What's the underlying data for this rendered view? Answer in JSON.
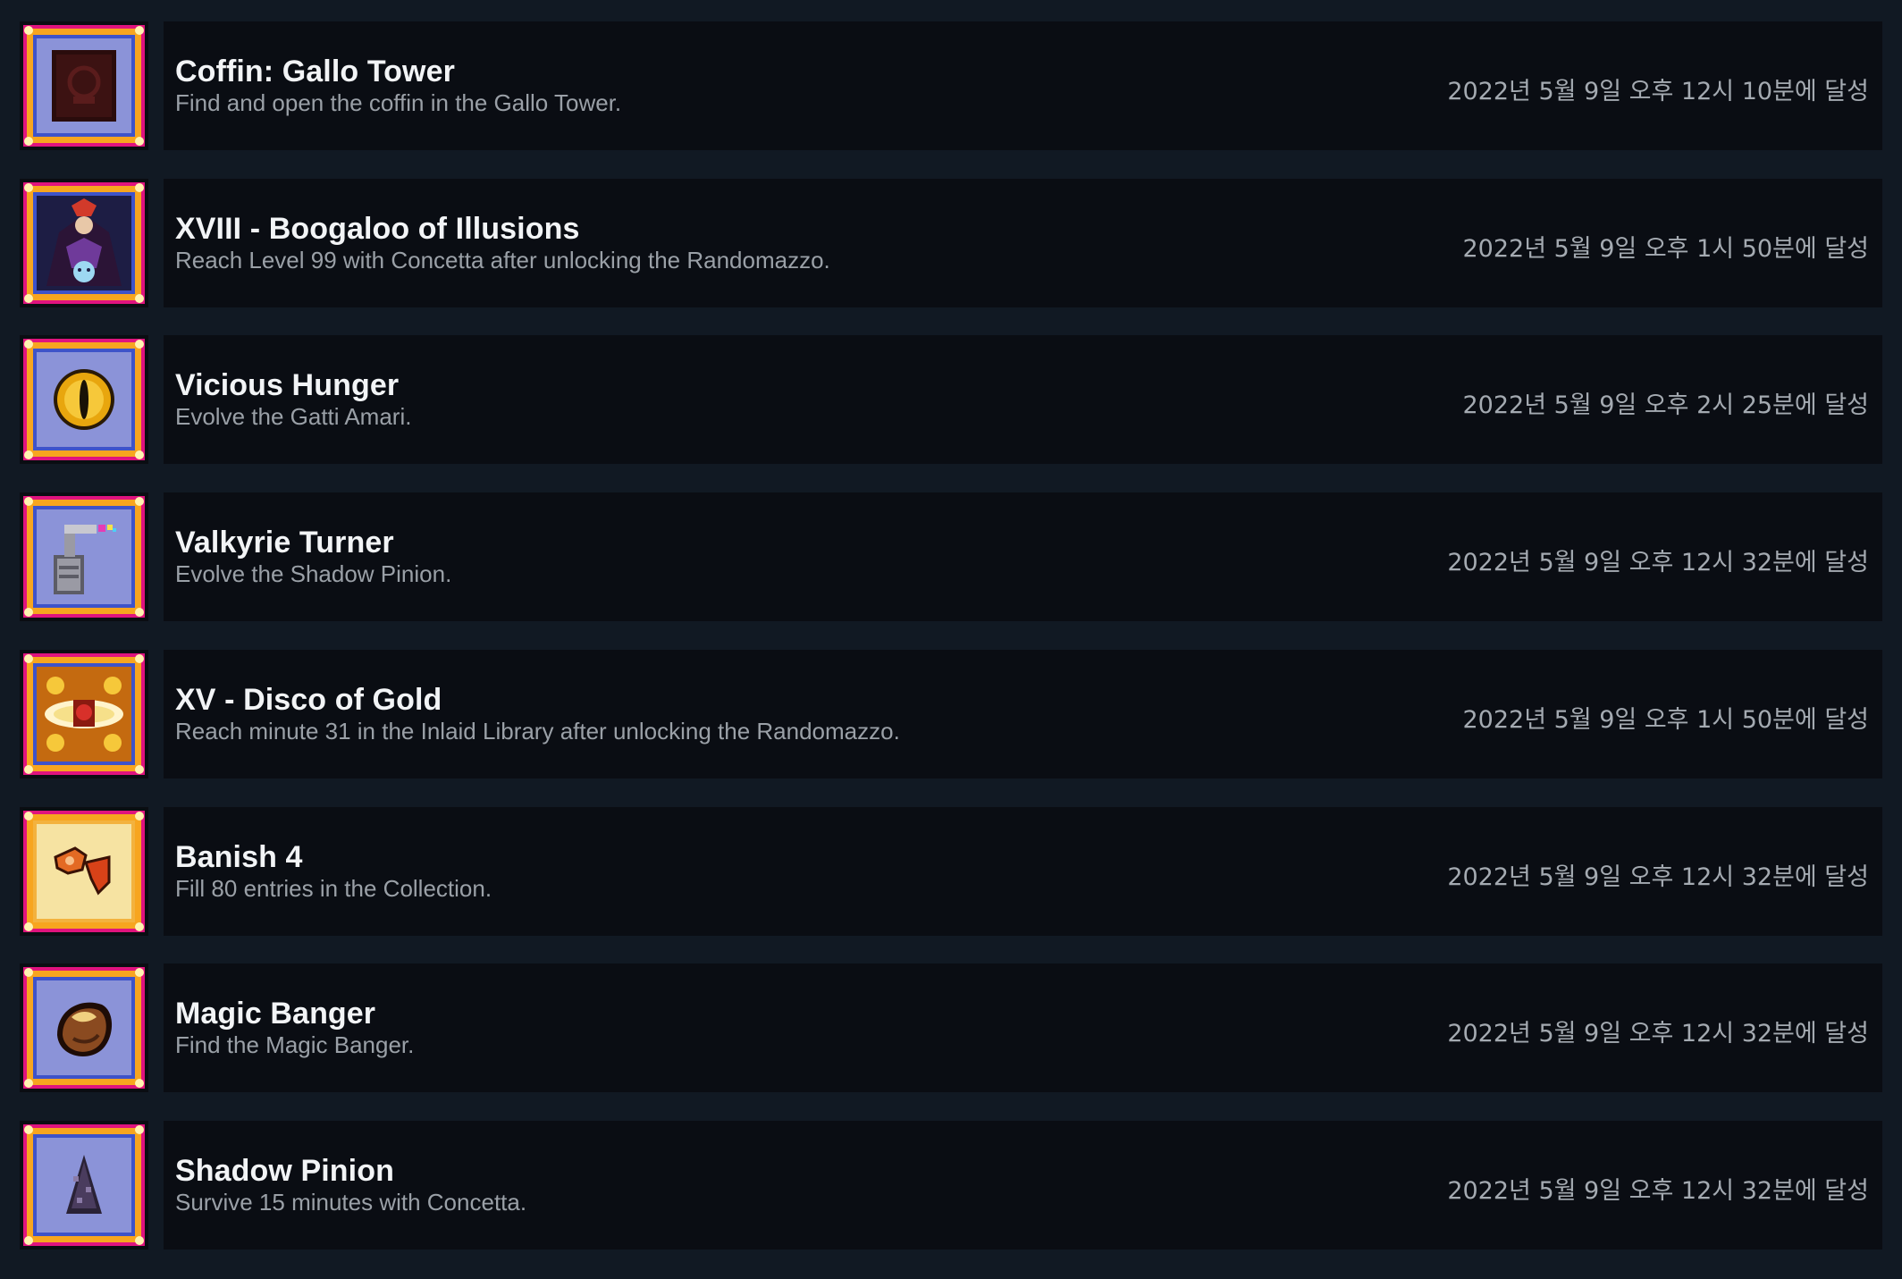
{
  "achievements": [
    {
      "title": "Coffin: Gallo Tower",
      "description": "Find and open the coffin in the Gallo Tower.",
      "unlocked": "2022년 5월 9일 오후 12시 10분에 달성",
      "icon": "coffin-icon"
    },
    {
      "title": "XVIII - Boogaloo of Illusions",
      "description": "Reach Level 99 with Concetta after unlocking the Randomazzo.",
      "unlocked": "2022년 5월 9일 오후 1시 50분에 달성",
      "icon": "boogaloo-character-icon"
    },
    {
      "title": "Vicious Hunger",
      "description": "Evolve the Gatti Amari.",
      "unlocked": "2022년 5월 9일 오후 2시 25분에 달성",
      "icon": "golden-eye-icon"
    },
    {
      "title": "Valkyrie Turner",
      "description": "Evolve the Shadow Pinion.",
      "unlocked": "2022년 5월 9일 오후 12시 32분에 달성",
      "icon": "valkyrie-turner-icon"
    },
    {
      "title": "XV - Disco of Gold",
      "description": "Reach minute 31 in the Inlaid Library after unlocking the Randomazzo.",
      "unlocked": "2022년 5월 9일 오후 1시 50분에 달성",
      "icon": "disco-of-gold-icon"
    },
    {
      "title": "Banish 4",
      "description": "Fill 80 entries in the Collection.",
      "unlocked": "2022년 5월 9일 오후 12시 32분에 달성",
      "icon": "banish-hand-icon"
    },
    {
      "title": "Magic Banger",
      "description": "Find the Magic Banger.",
      "unlocked": "2022년 5월 9일 오후 12시 32분에 달성",
      "icon": "magic-banger-icon"
    },
    {
      "title": "Shadow Pinion",
      "description": "Survive 15 minutes with Concetta.",
      "unlocked": "2022년 5월 9일 오후 12시 32분에 달성",
      "icon": "shadow-pinion-icon"
    }
  ],
  "colors": {
    "page_background": "#111923",
    "card_background": "#0a0d13",
    "frame_gold": "#f7a51f",
    "frame_magenta": "#e0137e",
    "frame_blue": "#3e53c9",
    "title_text": "#f2f4f6",
    "desc_text": "#9aa0a7",
    "date_text": "#a4aab1"
  }
}
